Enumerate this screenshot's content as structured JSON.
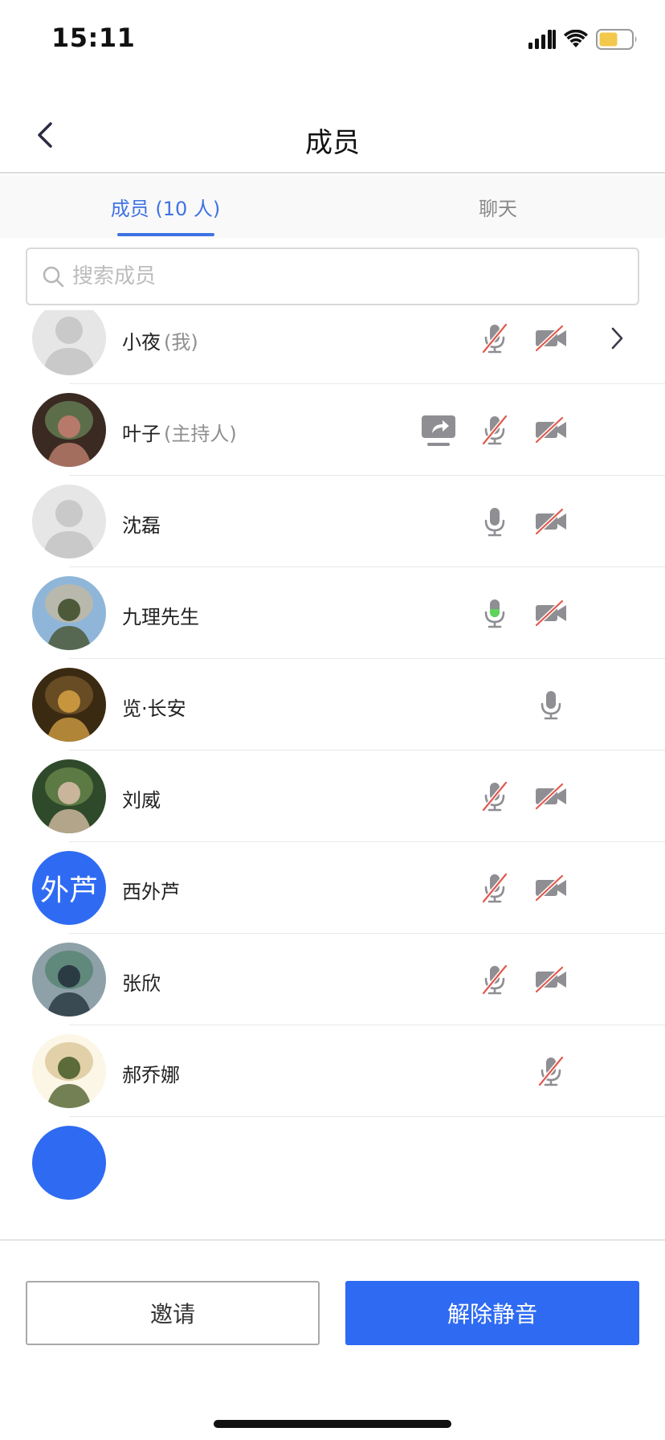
{
  "status_bar": {
    "time": "15:11",
    "battery_color": "#f2c94c"
  },
  "nav": {
    "title": "成员",
    "back_icon": "chevron-left-icon"
  },
  "tabs": [
    {
      "label": "成员 (10 人)",
      "active": true
    },
    {
      "label": "聊天",
      "active": false
    }
  ],
  "search": {
    "placeholder": "搜索成员",
    "value": ""
  },
  "members": [
    {
      "name": "小夜",
      "role": "(我)",
      "avatar": "placeholder",
      "mic": "muted",
      "camera": "off",
      "share": false,
      "chevron": true
    },
    {
      "name": "叶子",
      "role": "(主持人)",
      "avatar": "photo",
      "mic": "muted",
      "camera": "off",
      "share": true,
      "chevron": false
    },
    {
      "name": "沈磊",
      "role": "",
      "avatar": "placeholder",
      "mic": "on",
      "camera": "off",
      "share": false,
      "chevron": false
    },
    {
      "name": "九理先生",
      "role": "",
      "avatar": "photo",
      "mic": "speaking",
      "camera": "off",
      "share": false,
      "chevron": false
    },
    {
      "name": "览·长安",
      "role": "",
      "avatar": "photo",
      "mic": "on",
      "camera": "none",
      "share": false,
      "chevron": false
    },
    {
      "name": "刘威",
      "role": "",
      "avatar": "photo",
      "mic": "muted",
      "camera": "off",
      "share": false,
      "chevron": false
    },
    {
      "name": "西外芦",
      "role": "",
      "avatar": "text",
      "avatar_text": "外芦",
      "mic": "muted",
      "camera": "off",
      "share": false,
      "chevron": false
    },
    {
      "name": "张欣",
      "role": "",
      "avatar": "photo",
      "mic": "muted",
      "camera": "off",
      "share": false,
      "chevron": false
    },
    {
      "name": "郝乔娜",
      "role": "",
      "avatar": "photo",
      "mic": "muted",
      "camera": "none",
      "share": false,
      "chevron": false
    }
  ],
  "footer": {
    "invite_label": "邀请",
    "unmute_label": "解除静音"
  },
  "colors": {
    "accent": "#2f6bf2",
    "tab_active": "#3f73e3",
    "mute_slash": "#e05a4f",
    "speaking": "#5ed35b",
    "icon_gray": "#8e8e93"
  }
}
